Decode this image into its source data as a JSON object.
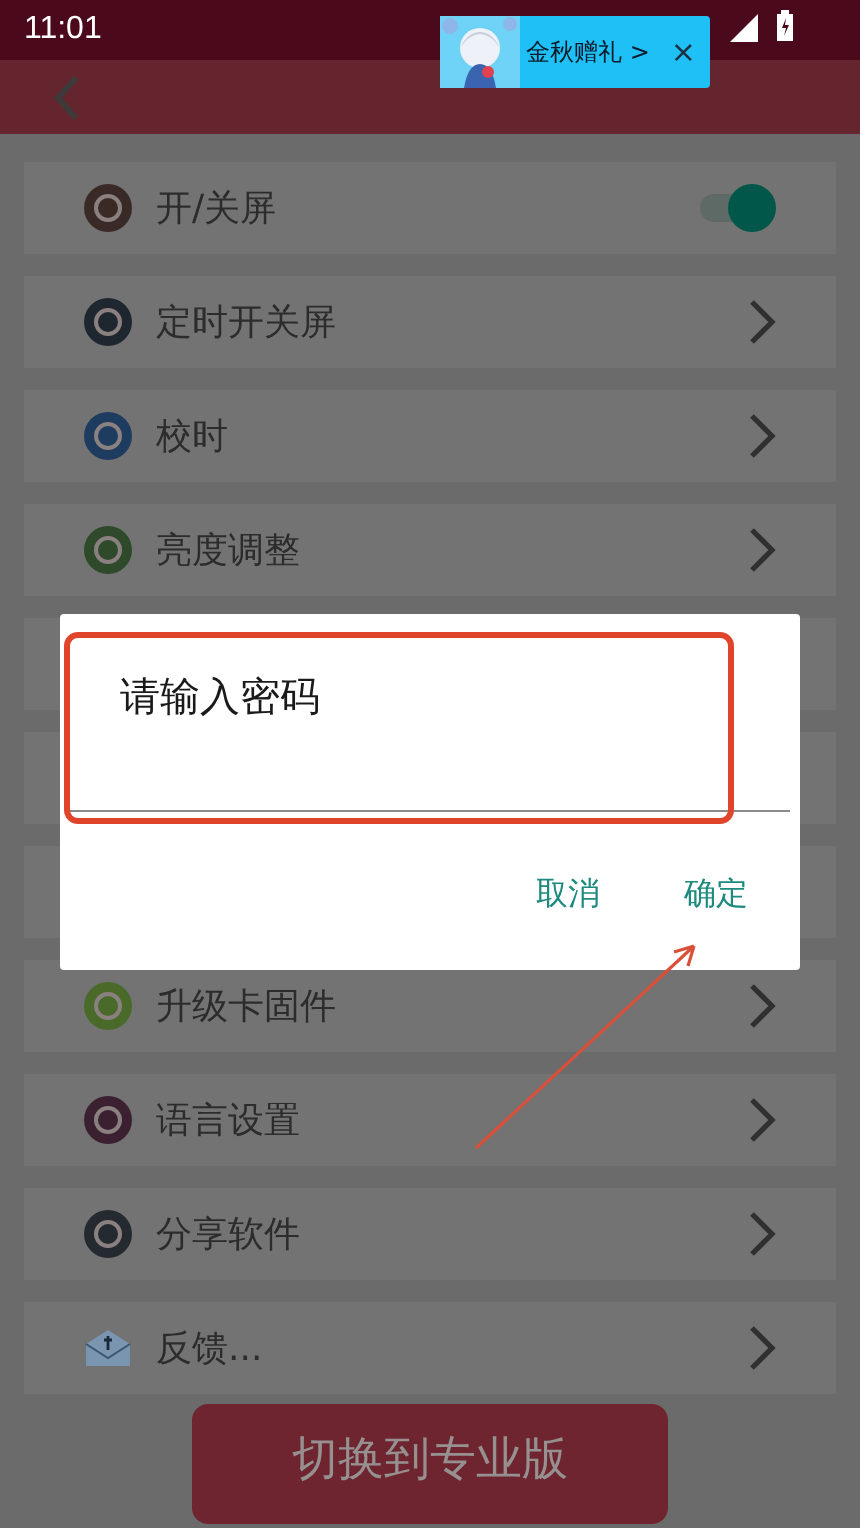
{
  "status_bar": {
    "time": "11:01"
  },
  "promo_banner": {
    "label": "金秋赠礼 >",
    "close": "×"
  },
  "settings": [
    {
      "kind": "toggle",
      "label": "开/关屏",
      "on": true
    },
    {
      "kind": "link",
      "label": "定时开关屏"
    },
    {
      "kind": "link",
      "label": "校时"
    },
    {
      "kind": "link",
      "label": "亮度调整"
    },
    {
      "kind": "covered"
    },
    {
      "kind": "covered"
    },
    {
      "kind": "covered"
    },
    {
      "kind": "link",
      "label": "升级卡固件"
    },
    {
      "kind": "link",
      "label": "语言设置"
    },
    {
      "kind": "link",
      "label": "分享软件"
    },
    {
      "kind": "link",
      "label": "反馈..."
    }
  ],
  "switch_button": {
    "label": "切换到专业版"
  },
  "dialog": {
    "title": "请输入密码",
    "buttons": [
      "取消",
      "确定"
    ]
  }
}
